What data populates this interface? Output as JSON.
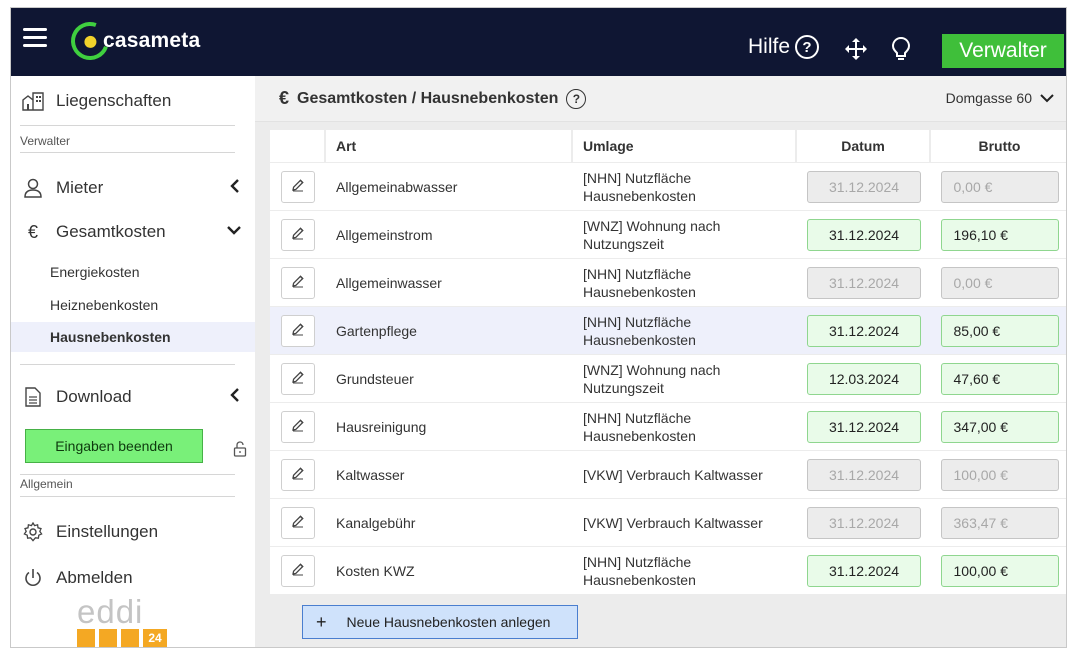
{
  "app": {
    "logo_text": "casameta",
    "help_label": "Hilfe",
    "help_symbol": "?",
    "role_button": "Verwalter"
  },
  "colors": {
    "topbar": "#0f1633",
    "accent_green": "#3fbf3a",
    "finish_green": "#79f079",
    "active_field": "#e9fbe9",
    "disabled_field": "#ececec",
    "highlight_row": "#eef0fb",
    "new_button": "#cfe2fb"
  },
  "sidebar": {
    "liegenschaften": "Liegenschaften",
    "section_verwalter": "Verwalter",
    "mieter": "Mieter",
    "gesamtkosten": "Gesamtkosten",
    "gesamtkosten_icon": "€",
    "sub_items": [
      "Energiekosten",
      "Heiznebenkosten",
      "Hausnebenkosten"
    ],
    "download": "Download",
    "finish_button": "Eingaben beenden",
    "section_allgemein": "Allgemein",
    "einstellungen": "Einstellungen",
    "abmelden": "Abmelden",
    "footer_logo": "eddi",
    "footer_badge": "24"
  },
  "header": {
    "icon": "€",
    "title": "Gesamtkosten / Hausnebenkosten",
    "help_symbol": "?",
    "property": "Domgasse 60"
  },
  "table": {
    "columns": {
      "art": "Art",
      "umlage": "Umlage",
      "datum": "Datum",
      "brutto": "Brutto"
    },
    "rows": [
      {
        "art": "Allgemeinabwasser",
        "umlage": "[NHN] Nutzfläche Hausnebenkosten",
        "datum": "31.12.2024",
        "brutto": "0,00 €",
        "state": "disabled"
      },
      {
        "art": "Allgemeinstrom",
        "umlage": "[WNZ] Wohnung nach Nutzungszeit",
        "datum": "31.12.2024",
        "brutto": "196,10 €",
        "state": "active"
      },
      {
        "art": "Allgemeinwasser",
        "umlage": "[NHN] Nutzfläche Hausnebenkosten",
        "datum": "31.12.2024",
        "brutto": "0,00 €",
        "state": "disabled"
      },
      {
        "art": "Gartenpflege",
        "umlage": "[NHN] Nutzfläche Hausnebenkosten",
        "datum": "31.12.2024",
        "brutto": "85,00 €",
        "state": "active"
      },
      {
        "art": "Grundsteuer",
        "umlage": "[WNZ] Wohnung nach Nutzungszeit",
        "datum": "12.03.2024",
        "brutto": "47,60 €",
        "state": "active"
      },
      {
        "art": "Hausreinigung",
        "umlage": "[NHN] Nutzfläche Hausnebenkosten",
        "datum": "31.12.2024",
        "brutto": "347,00 €",
        "state": "active"
      },
      {
        "art": "Kaltwasser",
        "umlage": "[VKW] Verbrauch Kaltwasser",
        "datum": "31.12.2024",
        "brutto": "100,00 €",
        "state": "disabled"
      },
      {
        "art": "Kanalgebühr",
        "umlage": "[VKW] Verbrauch Kaltwasser",
        "datum": "31.12.2024",
        "brutto": "363,47 €",
        "state": "disabled"
      },
      {
        "art": "Kosten KWZ",
        "umlage": "[NHN] Nutzfläche Hausnebenkosten",
        "datum": "31.12.2024",
        "brutto": "100,00 €",
        "state": "active"
      }
    ]
  },
  "new_button": {
    "symbol": "+",
    "label": "Neue Hausnebenkosten anlegen"
  }
}
